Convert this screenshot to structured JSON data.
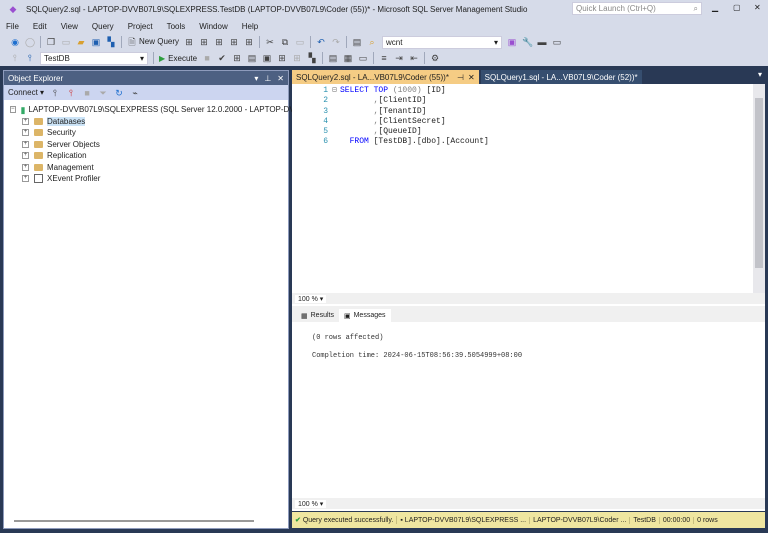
{
  "window": {
    "title": "SQLQuery2.sql - LAPTOP-DVVB07L9\\SQLEXPRESS.TestDB (LAPTOP-DVVB07L9\\Coder (55))* - Microsoft SQL Server Management Studio",
    "quick_launch_placeholder": "Quick Launch (Ctrl+Q)"
  },
  "menu": [
    "File",
    "Edit",
    "View",
    "Query",
    "Project",
    "Tools",
    "Window",
    "Help"
  ],
  "toolbar": {
    "new_query": "New Query",
    "search_value": "wcnt",
    "database": "TestDB",
    "execute": "Execute"
  },
  "object_explorer": {
    "title": "Object Explorer",
    "connect": "Connect",
    "server": "LAPTOP-DVVB07L9\\SQLEXPRESS (SQL Server 12.0.2000 - LAPTOP-DVVB07L9\\Coder)",
    "nodes": [
      "Databases",
      "Security",
      "Server Objects",
      "Replication",
      "Management",
      "XEvent Profiler"
    ]
  },
  "tabs": [
    {
      "label": "SQLQuery2.sql - LA...VB07L9\\Coder (55))*"
    },
    {
      "label": "SQLQuery1.sql - LA...VB07L9\\Coder (52))*"
    }
  ],
  "editor": {
    "lines": [
      {
        "n": "1",
        "kw": "SELECT TOP ",
        "gr": "(1000) ",
        "rest": "[ID]"
      },
      {
        "n": "2",
        "kw": "",
        "gr": "       ,",
        "rest": "[ClientID]"
      },
      {
        "n": "3",
        "kw": "",
        "gr": "       ,",
        "rest": "[TenantID]"
      },
      {
        "n": "4",
        "kw": "",
        "gr": "       ,",
        "rest": "[ClientSecret]"
      },
      {
        "n": "5",
        "kw": "",
        "gr": "       ,",
        "rest": "[QueueID]"
      },
      {
        "n": "6",
        "kw": "  FROM ",
        "gr": "",
        "rest": "[TestDB].[dbo].[Account]"
      }
    ],
    "zoom": "100 %"
  },
  "results": {
    "tabs": [
      "Results",
      "Messages"
    ],
    "messages": [
      "(0 rows affected)",
      "Completion time: 2024-06-15T08:56:39.5054999+08:00"
    ],
    "zoom": "100 %"
  },
  "status": {
    "message": "Query executed successfully.",
    "server": "LAPTOP-DVVB07L9\\SQLEXPRESS ...",
    "user": "LAPTOP-DVVB07L9\\Coder ...",
    "database": "TestDB",
    "time": "00:00:00",
    "rows": "0 rows"
  }
}
